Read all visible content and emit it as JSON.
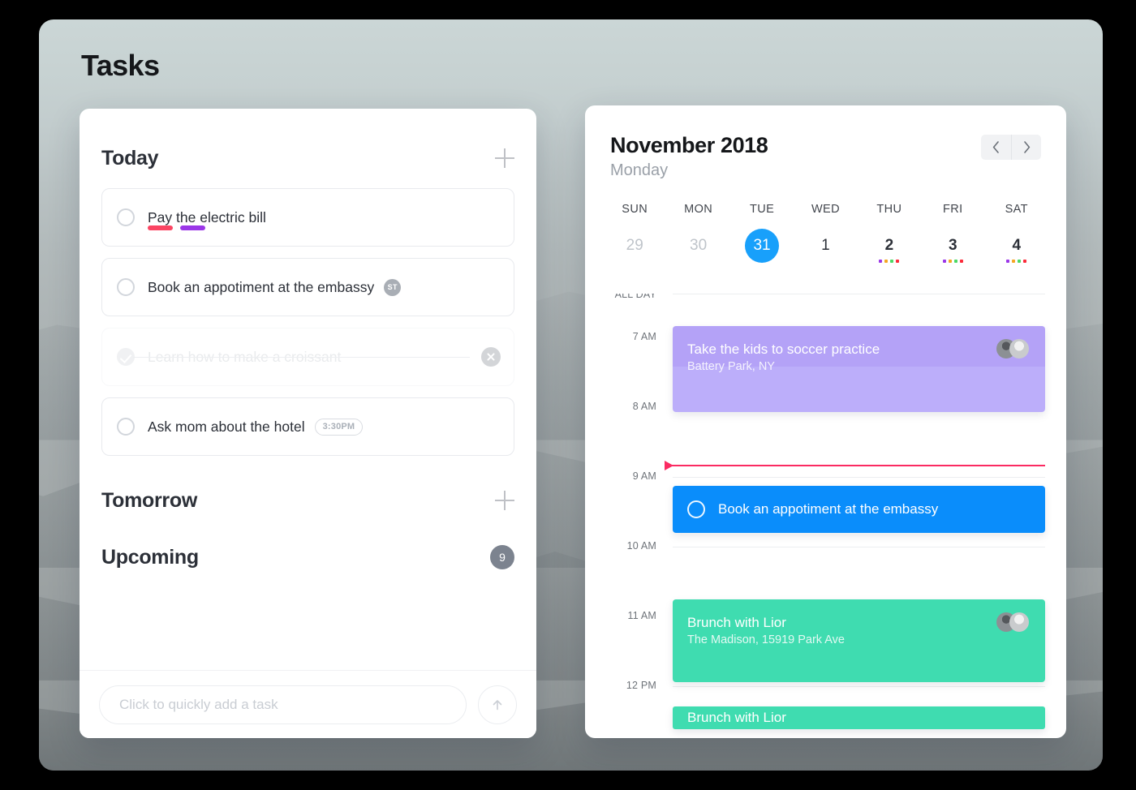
{
  "page": {
    "title": "Tasks"
  },
  "tasks_panel": {
    "sections": [
      {
        "title": "Today",
        "action": "add"
      },
      {
        "title": "Tomorrow",
        "action": "add"
      },
      {
        "title": "Upcoming",
        "badge": "9"
      }
    ],
    "today_tasks": [
      {
        "label": "Pay the electric bill",
        "done": false,
        "tags": [
          "#fb4563",
          "#9b37e8"
        ]
      },
      {
        "label": "Book an appotiment at the embassy",
        "done": false,
        "avatar_initials": "ST"
      },
      {
        "label": "Learn how to make a croissant",
        "done": true
      },
      {
        "label": "Ask mom about the hotel",
        "done": false,
        "time": "3:30PM"
      }
    ],
    "quick_add": {
      "placeholder": "Click to quickly add a task",
      "value": "",
      "send_icon": "arrow-up-icon"
    }
  },
  "calendar": {
    "month": "November 2018",
    "weekday": "Monday",
    "nav": {
      "prev": "‹",
      "next": "›"
    },
    "day_names": [
      "SUN",
      "MON",
      "TUE",
      "WED",
      "THU",
      "FRI",
      "SAT"
    ],
    "dates": [
      {
        "num": "29",
        "muted": true,
        "active": false,
        "dots": []
      },
      {
        "num": "30",
        "muted": true,
        "active": false,
        "dots": []
      },
      {
        "num": "31",
        "muted": false,
        "active": true,
        "dots": []
      },
      {
        "num": "1",
        "muted": false,
        "active": false,
        "dots": []
      },
      {
        "num": "2",
        "muted": false,
        "active": false,
        "dots": [
          "#9b37e8",
          "#f5a623",
          "#4cd964",
          "#fb2b3a"
        ]
      },
      {
        "num": "3",
        "muted": false,
        "active": false,
        "dots": [
          "#9b37e8",
          "#f5a623",
          "#4cd964",
          "#fb2b3a"
        ]
      },
      {
        "num": "4",
        "muted": false,
        "active": false,
        "dots": [
          "#9b37e8",
          "#f5a623",
          "#4cd964",
          "#fb2b3a"
        ]
      }
    ],
    "time_slots": [
      "ALL DAY",
      "7 AM",
      "8 AM",
      "9 AM",
      "10 AM",
      "11 AM",
      "12 PM"
    ],
    "events": [
      {
        "title": "Take the kids to soccer practice",
        "location": "Battery Park, NY",
        "color": "#b4a2f7",
        "has_avatars": true,
        "has_checkbox": false
      },
      {
        "title": "Book an appotiment at the embassy",
        "location": "",
        "color": "#0a8dfb",
        "has_avatars": false,
        "has_checkbox": true
      },
      {
        "title": "Brunch with Lior",
        "location": "The Madison, 15919 Park Ave",
        "color": "#3fdcb0",
        "has_avatars": true,
        "has_checkbox": false
      },
      {
        "title": "Brunch with Lior",
        "location": "",
        "color": "#3fdcb0",
        "has_avatars": false,
        "has_checkbox": false
      }
    ],
    "now_indicator_color": "#fb2b62"
  }
}
